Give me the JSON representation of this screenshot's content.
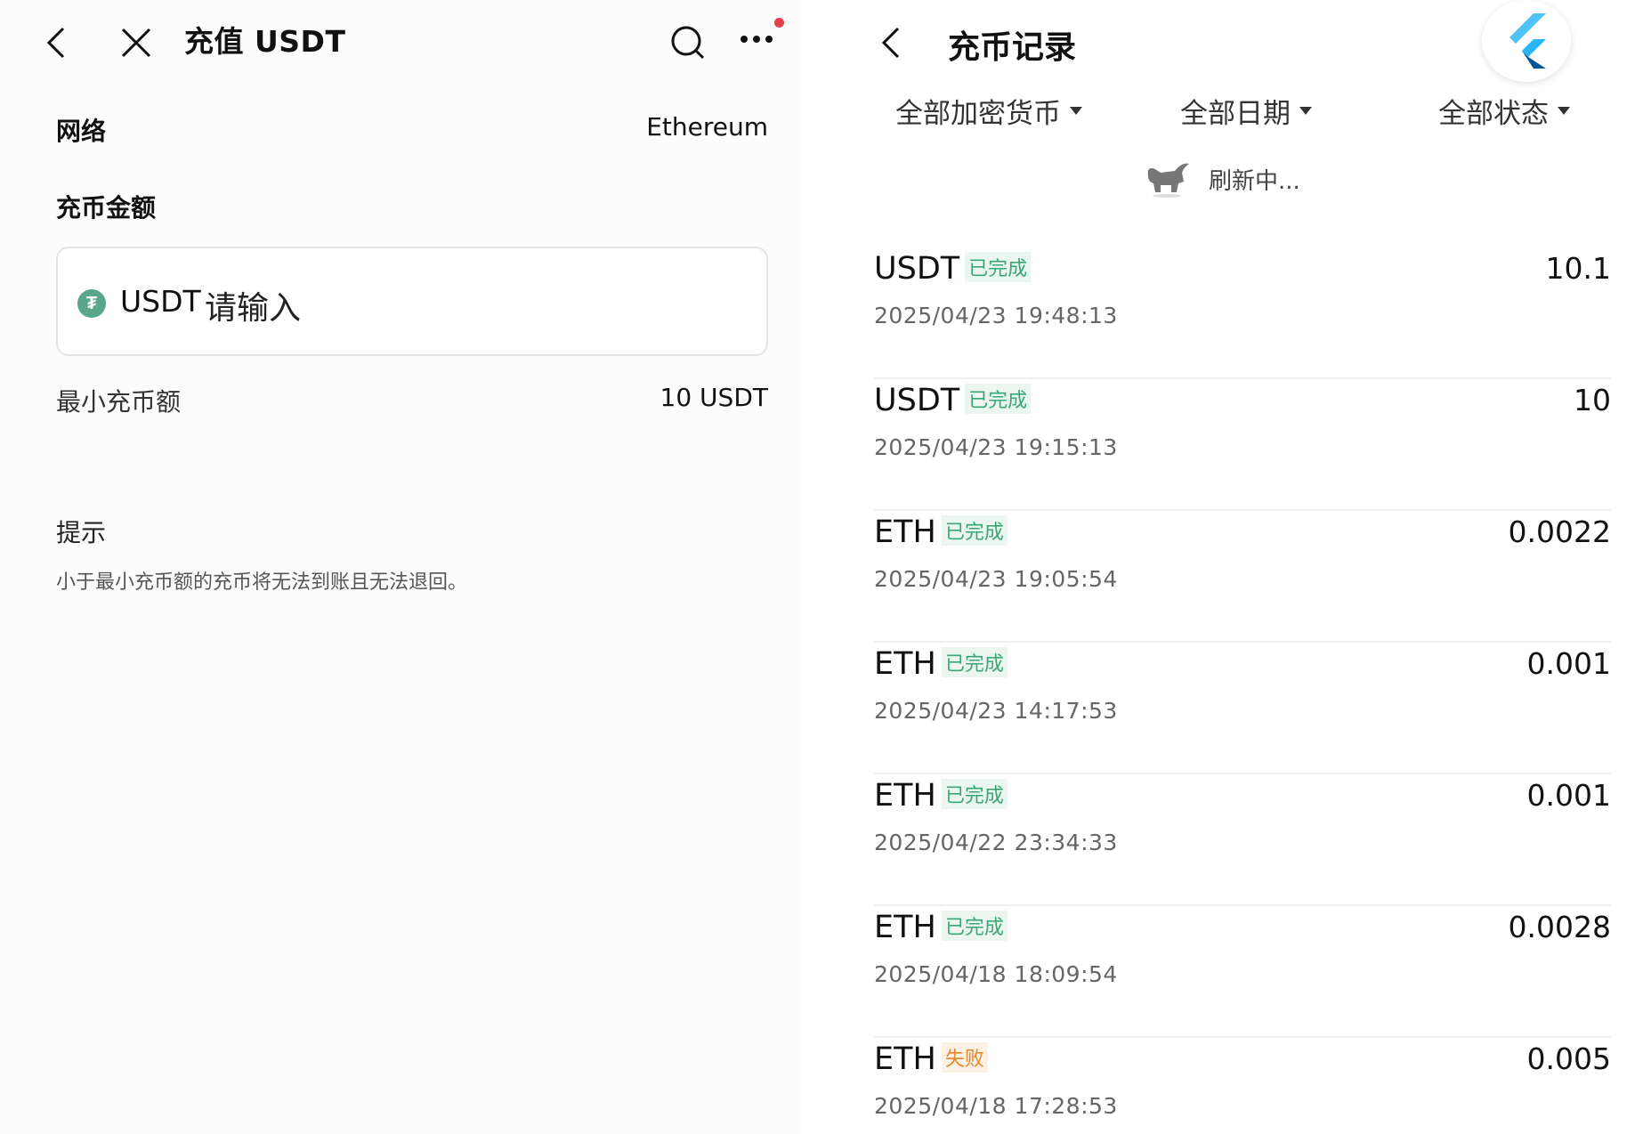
{
  "deposit": {
    "title": "充值 USDT",
    "network_label": "网络",
    "network_value": "Ethereum",
    "amount_label": "充币金额",
    "amount_coin": "USDT",
    "amount_placeholder": "请输入",
    "min_label": "最小充币额",
    "min_value": "10 USDT",
    "tip_title": "提示",
    "tip_text": "小于最小充币额的充币将无法到账且无法退回。"
  },
  "records": {
    "title": "充币记录",
    "filters": [
      "全部加密货币",
      "全部日期",
      "全部状态"
    ],
    "refresh_text": "刷新中...",
    "items": [
      {
        "coin": "USDT",
        "status": "已完成",
        "status_type": "ok",
        "time": "2025/04/23 19:48:13",
        "amount": "10.1"
      },
      {
        "coin": "USDT",
        "status": "已完成",
        "status_type": "ok",
        "time": "2025/04/23 19:15:13",
        "amount": "10"
      },
      {
        "coin": "ETH",
        "status": "已完成",
        "status_type": "ok",
        "time": "2025/04/23 19:05:54",
        "amount": "0.0022"
      },
      {
        "coin": "ETH",
        "status": "已完成",
        "status_type": "ok",
        "time": "2025/04/23 14:17:53",
        "amount": "0.001"
      },
      {
        "coin": "ETH",
        "status": "已完成",
        "status_type": "ok",
        "time": "2025/04/22 23:34:33",
        "amount": "0.001"
      },
      {
        "coin": "ETH",
        "status": "已完成",
        "status_type": "ok",
        "time": "2025/04/18 18:09:54",
        "amount": "0.0028"
      },
      {
        "coin": "ETH",
        "status": "失败",
        "status_type": "fail",
        "time": "2025/04/18 17:28:53",
        "amount": "0.005"
      }
    ]
  },
  "colors": {
    "success": "#3aa876",
    "failed": "#e2892c",
    "notification_dot": "#e0404a",
    "usdt_brand": "#5aa68a"
  },
  "icons": [
    "back-icon",
    "close-icon",
    "search-icon",
    "more-icon",
    "flutter-logo-icon",
    "bull-loading-icon"
  ]
}
